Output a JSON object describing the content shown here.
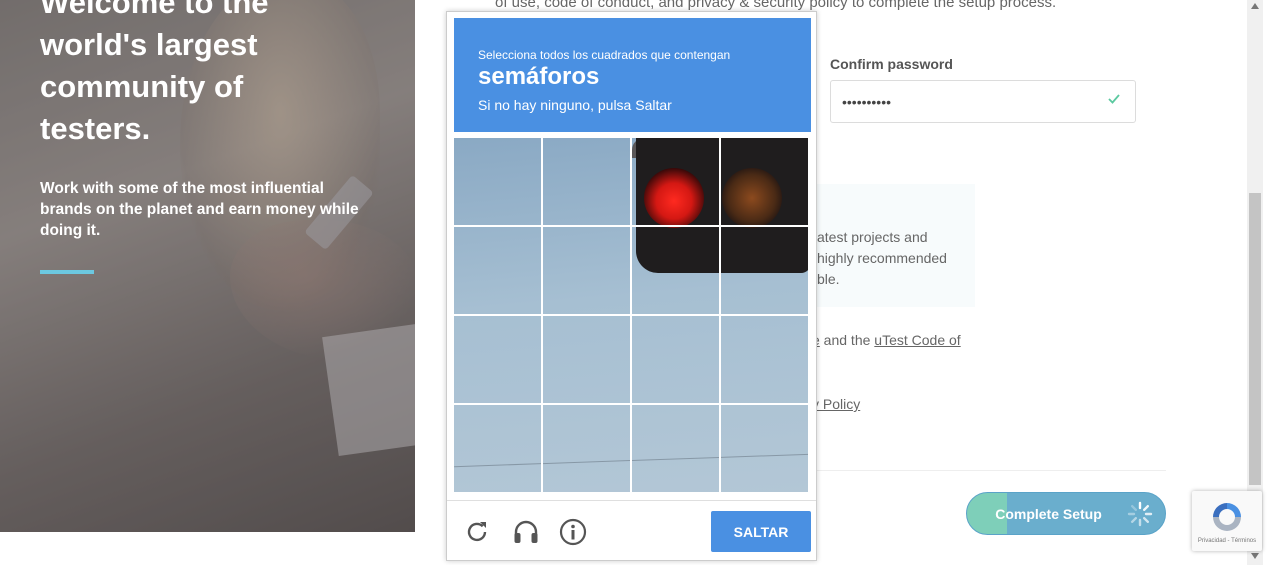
{
  "hero": {
    "title": "Welcome to the world's largest community of testers.",
    "subtitle": "Work with some of the most influential brands on the planet and earn money while doing it."
  },
  "form": {
    "intro_partial": "of use, code of conduct, and privacy & security policy to complete the setup process.",
    "confirm_password_label": "Confirm password",
    "confirm_password_value": "••••••••••",
    "info_partial": "atest projects and highly recommended ble.",
    "terms_partial_prefix": "e",
    "terms_partial_middle": " and the ",
    "terms_link": "uTest Code of",
    "privacy_partial": "y Policy",
    "complete_button": "Complete Setup"
  },
  "captcha": {
    "instruction": "Selecciona todos los cuadrados que contengan",
    "target": "semáforos",
    "hint": "Si no hay ninguno, pulsa Saltar",
    "skip_button": "SALTAR",
    "tile_count": 16,
    "icons": [
      "reload-icon",
      "headphones-icon",
      "info-icon"
    ]
  },
  "recaptcha_badge": {
    "text": "Privacidad - Términos"
  },
  "colors": {
    "captcha_blue": "#4a90e2",
    "accent_teal": "#7ecfb9",
    "button_blue": "#6aaecd",
    "hero_accent": "#6cc8e0"
  }
}
